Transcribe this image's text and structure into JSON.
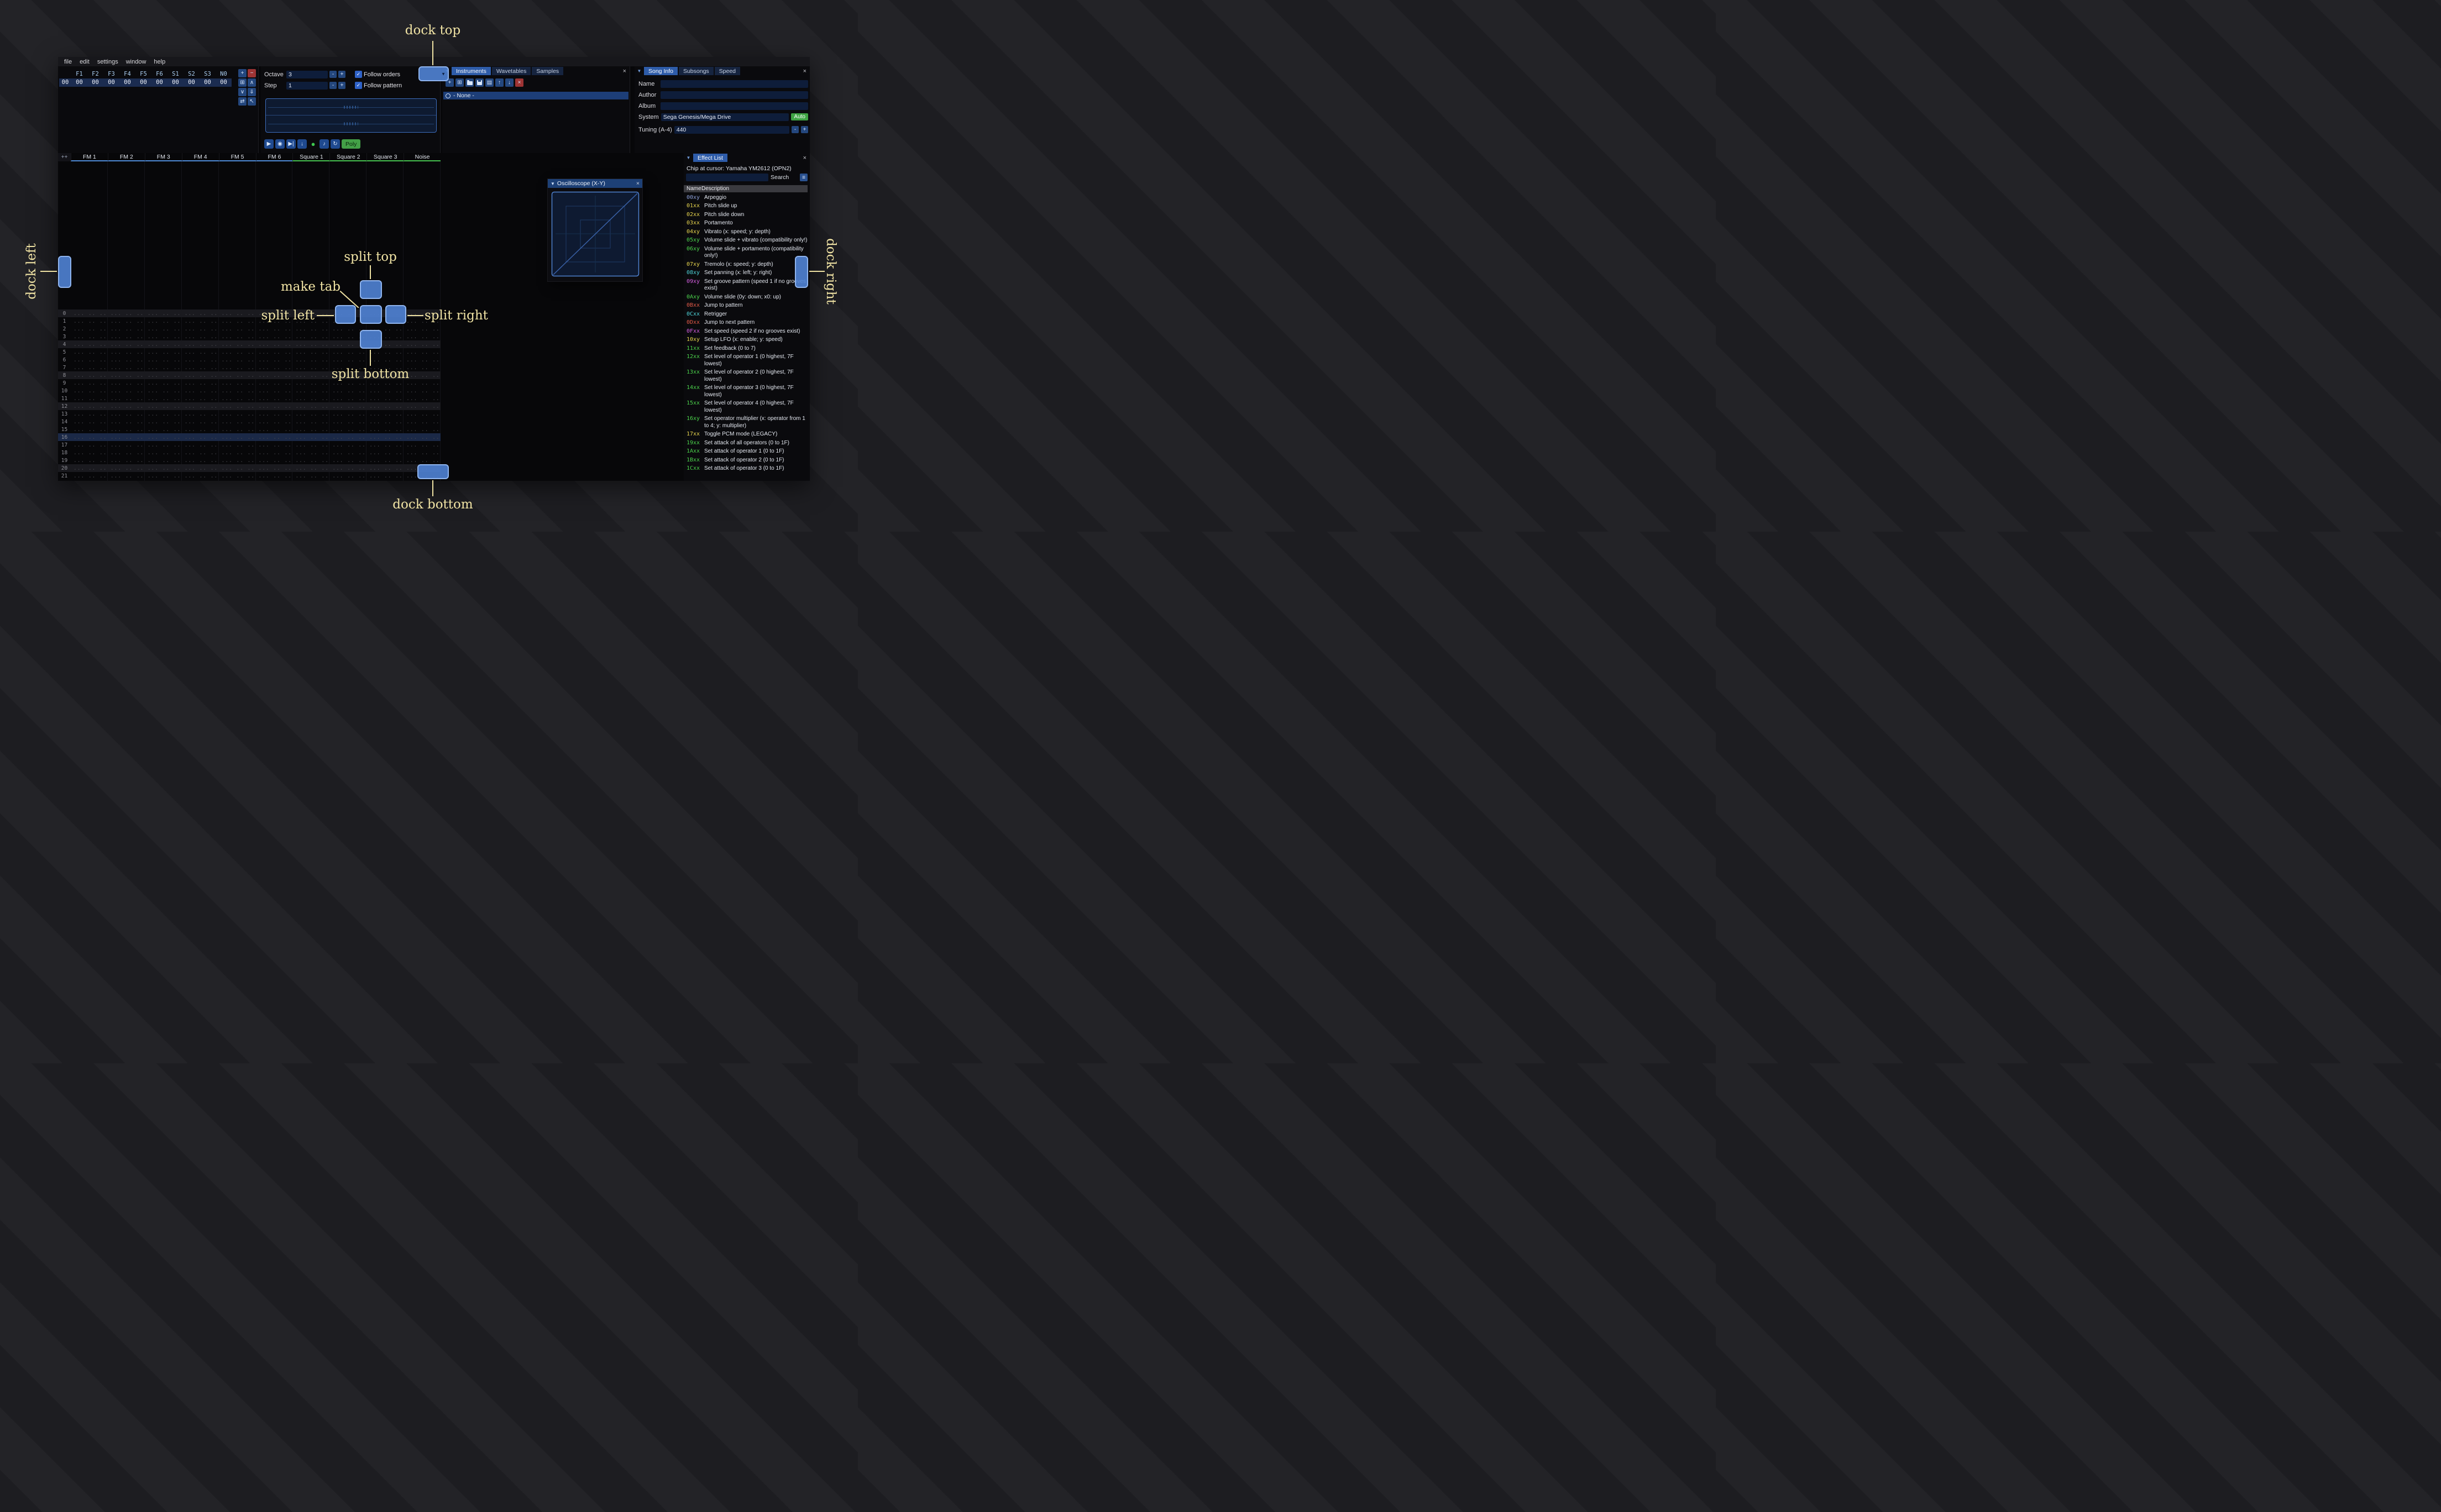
{
  "icons": {
    "collapse": "▼",
    "close": "×",
    "check": "✓",
    "menu": "≡",
    "dropdown": "▼"
  },
  "menu": {
    "items": [
      "file",
      "edit",
      "settings",
      "window",
      "help"
    ]
  },
  "orders": {
    "channels": [
      "F1",
      "F2",
      "F3",
      "F4",
      "F5",
      "F6",
      "S1",
      "S2",
      "S3",
      "N0"
    ],
    "rows": [
      {
        "index": "00",
        "values": [
          "00",
          "00",
          "00",
          "00",
          "00",
          "00",
          "00",
          "00",
          "00",
          "00"
        ]
      }
    ],
    "buttons": [
      {
        "name": "add-order-button",
        "glyph": "+",
        "style": "blue"
      },
      {
        "name": "remove-order-button",
        "glyph": "−",
        "style": "red"
      },
      {
        "name": "duplicate-order-button",
        "glyph": "⊞",
        "style": "blue"
      },
      {
        "name": "move-order-up-button",
        "glyph": "∧",
        "style": "blue"
      },
      {
        "name": "move-order-down-button",
        "glyph": "∨",
        "style": "blue"
      },
      {
        "name": "duplicate-order-to-end-button",
        "glyph": "⇓",
        "style": "blue"
      },
      {
        "name": "order-change-mode-button",
        "glyph": "⇄",
        "style": "blue"
      },
      {
        "name": "order-edit-mode-button",
        "glyph": "↖",
        "style": "blue"
      }
    ]
  },
  "controls": {
    "octave_label": "Octave",
    "octave_value": "3",
    "step_label": "Step",
    "step_value": "1",
    "minus": "-",
    "plus": "+",
    "follow_orders": "Follow orders",
    "follow_pattern": "Follow pattern",
    "transport": [
      {
        "name": "play-button",
        "glyph": "▶"
      },
      {
        "name": "play-pattern-button",
        "glyph": "◉"
      },
      {
        "name": "play-from-cursor-button",
        "glyph": "▶|"
      },
      {
        "name": "step-row-button",
        "glyph": "↓"
      },
      {
        "name": "record-button",
        "glyph": "●",
        "accent": "#3fc94f"
      },
      {
        "name": "metronome-button",
        "glyph": "♪"
      },
      {
        "name": "repeat-button",
        "glyph": "↻"
      }
    ],
    "poly_label": "Poly"
  },
  "instruments": {
    "tabs": [
      "Instruments",
      "Wavetables",
      "Samples"
    ],
    "active_tab": 0,
    "toolbar": [
      {
        "name": "add-instrument-button",
        "glyph": "+",
        "style": "blue"
      },
      {
        "name": "duplicate-instrument-button",
        "glyph": "⊞",
        "style": "blue"
      },
      {
        "name": "open-instrument-button",
        "icon": "folder-icon",
        "style": "blue"
      },
      {
        "name": "save-instrument-button",
        "icon": "floppy-icon",
        "style": "blue"
      },
      {
        "name": "instrument-folders-button",
        "glyph": "▤",
        "style": "blue"
      },
      {
        "name": "move-instrument-up-button",
        "glyph": "↑",
        "style": "blue"
      },
      {
        "name": "move-instrument-down-button",
        "glyph": "↓",
        "style": "blue"
      },
      {
        "name": "delete-instrument-button",
        "glyph": "×",
        "style": "red"
      }
    ],
    "list": [
      {
        "label": "- None -",
        "selected": true
      }
    ]
  },
  "song_info": {
    "tabs": [
      "Song Info",
      "Subsongs",
      "Speed"
    ],
    "active_tab": 0,
    "fields": [
      {
        "label": "Name",
        "value": ""
      },
      {
        "label": "Author",
        "value": ""
      },
      {
        "label": "Album",
        "value": ""
      }
    ],
    "system_label": "System",
    "system_value": "Sega Genesis/Mega Drive",
    "auto_label": "Auto",
    "tuning_label": "Tuning (A-4)",
    "tuning_value": "440"
  },
  "pattern": {
    "corner": "++",
    "channels": [
      {
        "label": "FM 1",
        "color": "#4e8ad6"
      },
      {
        "label": "FM 2",
        "color": "#4e8ad6"
      },
      {
        "label": "FM 3",
        "color": "#4e8ad6"
      },
      {
        "label": "FM 4",
        "color": "#4e8ad6"
      },
      {
        "label": "FM 5",
        "color": "#4e8ad6"
      },
      {
        "label": "FM 6",
        "color": "#4e8ad6"
      },
      {
        "label": "Square 1",
        "color": "#45c04f"
      },
      {
        "label": "Square 2",
        "color": "#45c04f"
      },
      {
        "label": "Square 3",
        "color": "#45c04f"
      },
      {
        "label": "Noise",
        "color": "#45c04f"
      }
    ],
    "row_first": 0,
    "row_last": 21,
    "empty_cell": "... .. .. ....",
    "highlight_every": 4,
    "selected_row": 16
  },
  "oscilloscope": {
    "title": "Oscilloscope (X-Y)"
  },
  "effect_list": {
    "title": "Effect List",
    "chip_line": "Chip at cursor: Yamaha YM2612 (OPN2)",
    "search_label": "Search",
    "search_value": "",
    "columns": [
      "Name",
      "Description"
    ],
    "effects": [
      {
        "code": "00xy",
        "color": "#8da0d8",
        "desc": "Arpeggio"
      },
      {
        "code": "01xx",
        "color": "#e7d54e",
        "desc": "Pitch slide up"
      },
      {
        "code": "02xx",
        "color": "#e7d54e",
        "desc": "Pitch slide down"
      },
      {
        "code": "03xx",
        "color": "#e7d54e",
        "desc": "Portamento"
      },
      {
        "code": "04xy",
        "color": "#e7d54e",
        "desc": "Vibrato (x: speed; y: depth)"
      },
      {
        "code": "05xy",
        "color": "#4cd44c",
        "desc": "Volume slide + vibrato (compatibility only!)"
      },
      {
        "code": "06xy",
        "color": "#4cd44c",
        "desc": "Volume slide + portamento (compatibility only!)"
      },
      {
        "code": "07xy",
        "color": "#e7d54e",
        "desc": "Tremolo (x: speed; y: depth)"
      },
      {
        "code": "08xy",
        "color": "#4ed3d8",
        "desc": "Set panning (x: left; y: right)"
      },
      {
        "code": "09xy",
        "color": "#d55fe0",
        "desc": "Set groove pattern (speed 1 if no grooves exist)"
      },
      {
        "code": "0Axy",
        "color": "#4cd44c",
        "desc": "Volume slide (0y: down; x0: up)"
      },
      {
        "code": "0Bxx",
        "color": "#e25a48",
        "desc": "Jump to pattern"
      },
      {
        "code": "0Cxx",
        "color": "#4ed3d8",
        "desc": "Retrigger"
      },
      {
        "code": "0Dxx",
        "color": "#e25a48",
        "desc": "Jump to next pattern"
      },
      {
        "code": "0Fxx",
        "color": "#d55fe0",
        "desc": "Set speed (speed 2 if no grooves exist)"
      },
      {
        "code": "10xy",
        "color": "#e7d54e",
        "desc": "Setup LFO (x: enable; y: speed)"
      },
      {
        "code": "11xx",
        "color": "#4cd44c",
        "desc": "Set feedback (0 to 7)"
      },
      {
        "code": "12xx",
        "color": "#4cd44c",
        "desc": "Set level of operator 1 (0 highest, 7F lowest)"
      },
      {
        "code": "13xx",
        "color": "#4cd44c",
        "desc": "Set level of operator 2 (0 highest, 7F lowest)"
      },
      {
        "code": "14xx",
        "color": "#4cd44c",
        "desc": "Set level of operator 3 (0 highest, 7F lowest)"
      },
      {
        "code": "15xx",
        "color": "#4cd44c",
        "desc": "Set level of operator 4 (0 highest, 7F lowest)"
      },
      {
        "code": "16xy",
        "color": "#4cd44c",
        "desc": "Set operator multiplier (x: operator from 1 to 4; y: multiplier)"
      },
      {
        "code": "17xx",
        "color": "#e7d54e",
        "desc": "Toggle PCM mode (LEGACY)"
      },
      {
        "code": "19xx",
        "color": "#4cd44c",
        "desc": "Set attack of all operators (0 to 1F)"
      },
      {
        "code": "1Axx",
        "color": "#4cd44c",
        "desc": "Set attack of operator 1 (0 to 1F)"
      },
      {
        "code": "1Bxx",
        "color": "#4cd44c",
        "desc": "Set attack of operator 2 (0 to 1F)"
      },
      {
        "code": "1Cxx",
        "color": "#4cd44c",
        "desc": "Set attack of operator 3 (0 to 1F)"
      }
    ]
  },
  "annotations": {
    "dock_top": "dock top",
    "dock_bottom": "dock bottom",
    "dock_left": "dock left",
    "dock_right": "dock right",
    "split_top": "split top",
    "split_bottom": "split bottom",
    "split_left": "split left",
    "split_right": "split right",
    "make_tab": "make tab"
  }
}
